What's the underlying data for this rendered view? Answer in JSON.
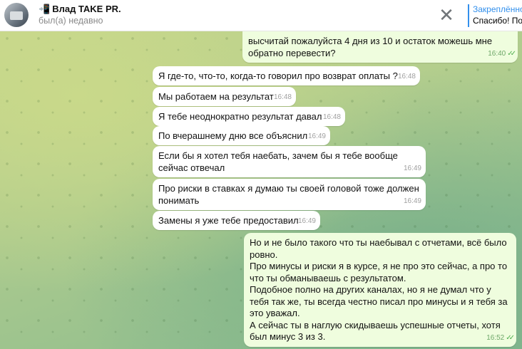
{
  "header": {
    "phone_icon": "mobile-phone-icon",
    "title": "Влад TAKE PR.",
    "status": "был(а) недавно",
    "close_glyph": "✕",
    "pinned_title": "Закреплённо",
    "pinned_text": "Спасибо! Под"
  },
  "messages": [
    {
      "dir": "out",
      "text": "высчитай пожалуйста 4 дня из 10 и остаток можешь мне обратно перевести?",
      "time": "16:40",
      "read": true
    },
    {
      "dir": "in",
      "text": "Я где-то, что-то, когда-то говорил про возврат оплаты ?",
      "time": "16:48"
    },
    {
      "dir": "in",
      "text": "Мы работаем на результат",
      "time": "16:48"
    },
    {
      "dir": "in",
      "text": "Я тебе неоднократно результат давал",
      "time": "16:48"
    },
    {
      "dir": "in",
      "text": "По вчерашнему дню все объяснил",
      "time": "16:49"
    },
    {
      "dir": "in",
      "text": "Если бы я хотел тебя наебать, зачем бы я тебе вообще сейчас отвечал",
      "time": "16:49"
    },
    {
      "dir": "in",
      "text": "Про риски в ставках я думаю ты своей головой тоже должен понимать",
      "time": "16:49"
    },
    {
      "dir": "in",
      "text": "Замены я уже тебе предоставил",
      "time": "16:49"
    },
    {
      "dir": "out",
      "text": "Но и не было такого что ты наебывал с отчетами, всё было ровно.\nПро минусы и риски я в курсе, я не про это сейчас, а про то что ты обманываешь с результатом.\nПодобное полно на других каналах, но я не думал что у тебя так же, ты всегда честно писал про минусы и я тебя за это уважал.\nА сейчас ты в наглую скидываешь успешные отчеты, хотя был минус 3 из 3.",
      "time": "16:52",
      "read": true
    }
  ],
  "colors": {
    "accent": "#3390ec",
    "outgoing_bubble": "#effdde",
    "incoming_bubble": "#ffffff"
  }
}
